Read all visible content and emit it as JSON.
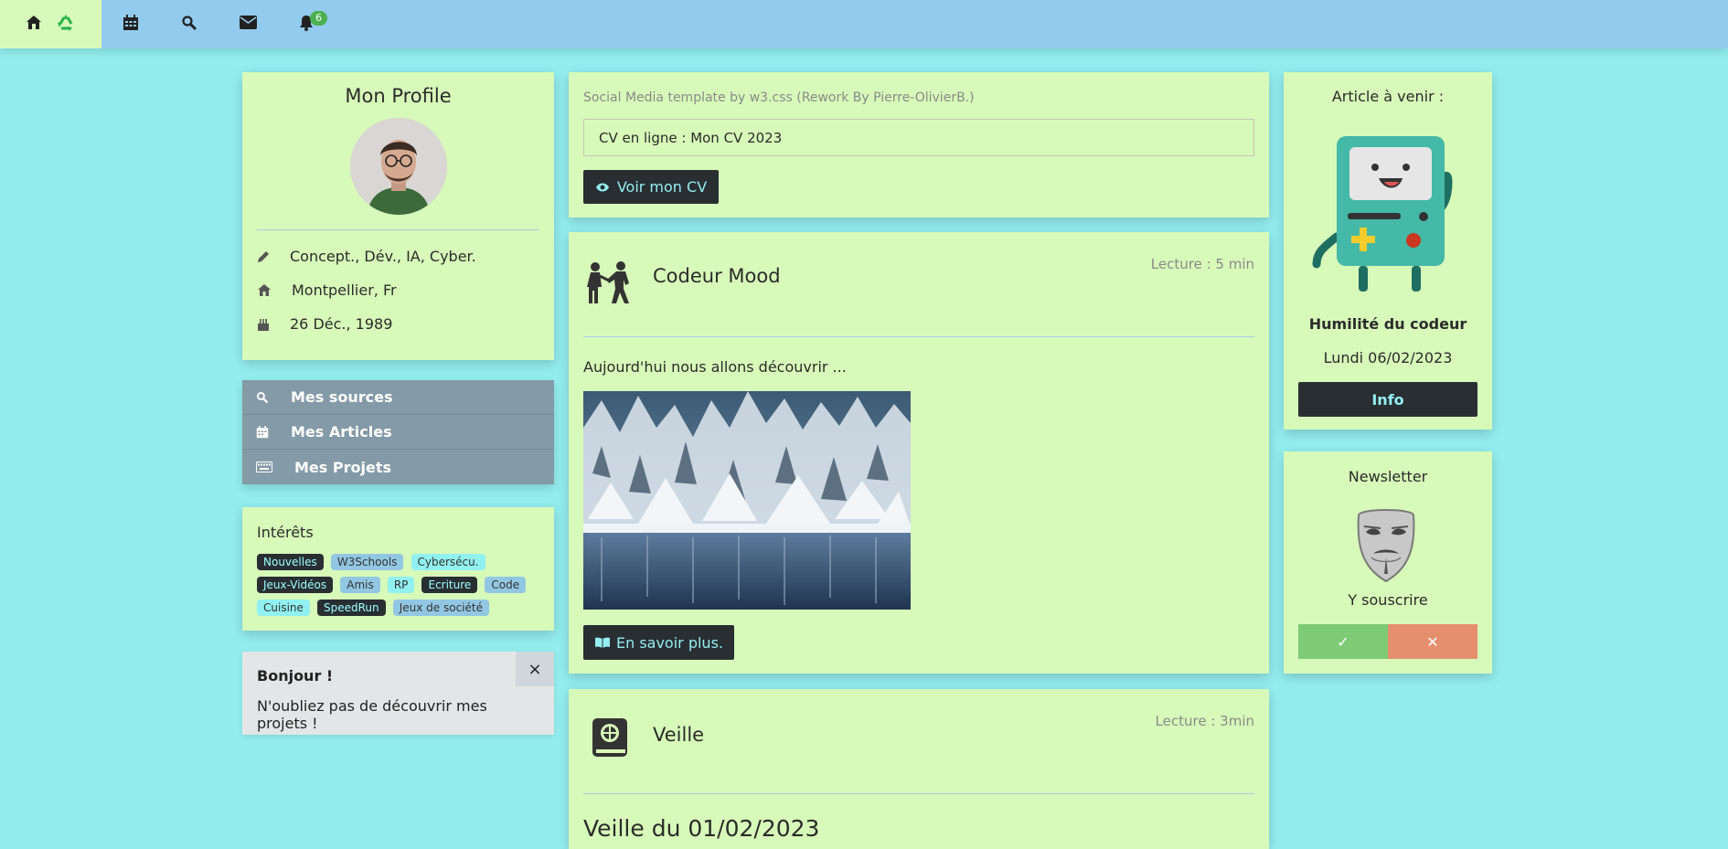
{
  "topbar": {
    "badge_count": "6",
    "icons": [
      "home-icon",
      "recycle-icon",
      "calendar-icon",
      "search-icon",
      "mail-icon",
      "bell-icon"
    ]
  },
  "profile": {
    "title": "Mon Profile",
    "rows": [
      {
        "icon": "pencil-icon",
        "text": "Concept., Dév., IA, Cyber."
      },
      {
        "icon": "home-icon",
        "text": "Montpellier, Fr"
      },
      {
        "icon": "cake-icon",
        "text": "26 Déc., 1989"
      }
    ]
  },
  "nav": {
    "items": [
      {
        "icon": "search-icon",
        "label": "Mes sources"
      },
      {
        "icon": "calendar-icon",
        "label": "Mes Articles"
      },
      {
        "icon": "keyboard-icon",
        "label": "Mes Projets"
      }
    ]
  },
  "interests": {
    "title": "Intérêts",
    "tags": [
      {
        "label": "Nouvelles",
        "style": "dark"
      },
      {
        "label": "W3Schools",
        "style": "blue"
      },
      {
        "label": "Cybersécu.",
        "style": "cyan"
      },
      {
        "label": "Jeux-Vidéos",
        "style": "dark"
      },
      {
        "label": "Amis",
        "style": "blue"
      },
      {
        "label": "RP",
        "style": "cyan"
      },
      {
        "label": "Ecriture",
        "style": "dark"
      },
      {
        "label": "Code",
        "style": "blue"
      },
      {
        "label": "Cuisine",
        "style": "cyan"
      },
      {
        "label": "SpeedRun",
        "style": "dark"
      },
      {
        "label": "Jeux de société",
        "style": "blue"
      }
    ]
  },
  "alert": {
    "title": "Bonjour !",
    "message": "N'oubliez pas de découvrir mes projets !",
    "close": "×"
  },
  "header_card": {
    "caption": "Social Media template by w3.css (Rework By Pierre-OlivierB.)",
    "input_value": "CV en ligne : Mon CV 2023",
    "button": "Voir mon CV"
  },
  "post1": {
    "title": "Codeur Mood",
    "reading": "Lecture : 5 min",
    "text": "Aujourd'hui nous allons découvrir ...",
    "button": "En savoir plus."
  },
  "post2": {
    "title": "Veille",
    "reading": "Lecture : 3min",
    "heading": "Veille du 01/02/2023"
  },
  "upcoming": {
    "title": "Article à venir :",
    "article": "Humilité du codeur",
    "date": "Lundi 06/02/2023",
    "button": "Info"
  },
  "newsletter": {
    "title": "Newsletter",
    "cta": "Y souscrire",
    "accept": "✓",
    "reject": "✕"
  },
  "colors": {
    "background": "#93edee",
    "topbar": "#92cbee",
    "card": "#d7f9b9",
    "dark": "#292e33",
    "accept": "#7ecb76",
    "reject": "#e58f6e"
  }
}
